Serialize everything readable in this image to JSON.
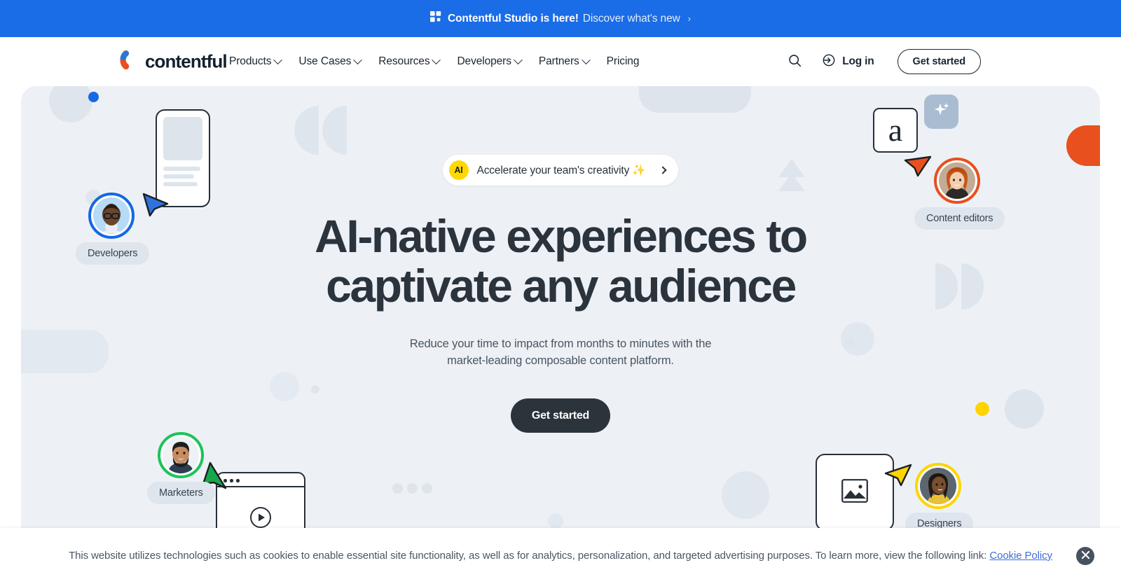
{
  "announcement": {
    "icon": "grid-squares-icon",
    "strong_text": "Contentful Studio is here!",
    "link_text": "Discover what's new",
    "chevron": "›",
    "bg_color": "#1a6ce7"
  },
  "nav": {
    "logo_text": "contentful",
    "logo_icon": "contentful-c-logo",
    "links": [
      {
        "label": "Products",
        "has_dropdown": true
      },
      {
        "label": "Use Cases",
        "has_dropdown": true
      },
      {
        "label": "Resources",
        "has_dropdown": true
      },
      {
        "label": "Developers",
        "has_dropdown": true
      },
      {
        "label": "Partners",
        "has_dropdown": true
      },
      {
        "label": "Pricing",
        "has_dropdown": false
      }
    ],
    "search_icon": "search-icon",
    "login_icon": "login-arrow-icon",
    "login_label": "Log in",
    "get_started_label": "Get started"
  },
  "hero": {
    "bg_color": "#edf1f6",
    "ai_pill": {
      "badge": "AI",
      "text": "Accelerate your team's creativity ✨",
      "chevron": "›"
    },
    "title": "AI-native experiences to captivate any audience",
    "subtitle": "Reduce your time to impact from months to minutes with the market-leading composable content platform.",
    "cta_label": "Get started"
  },
  "personas": [
    {
      "label": "Developers",
      "ring_color": "#1668e3",
      "cursor_color": "#2f72dd"
    },
    {
      "label": "Content editors",
      "ring_color": "#e8501e",
      "cursor_color": "#e8501e"
    },
    {
      "label": "Marketers",
      "ring_color": "#1ec35a",
      "cursor_color": "#17a74c"
    },
    {
      "label": "Designers",
      "ring_color": "#ffd400",
      "cursor_color": "#ffd400"
    }
  ],
  "decor": {
    "text_card_glyph": "a",
    "sparkle_icon": "sparkle-icon",
    "image_icon": "image-placeholder-icon",
    "play_icon": "play-button-icon",
    "accent_yellow": "#ffd400",
    "accent_orange": "#e8501e",
    "accent_blue": "#1668e3",
    "shape_color": "#dee5ed"
  },
  "cookie": {
    "message": "This website utilizes technologies such as cookies to enable essential site functionality, as well as for analytics, personalization, and targeted advertising purposes. To learn more, view the following link: ",
    "link_text": "Cookie Policy",
    "close_icon": "close-icon"
  }
}
